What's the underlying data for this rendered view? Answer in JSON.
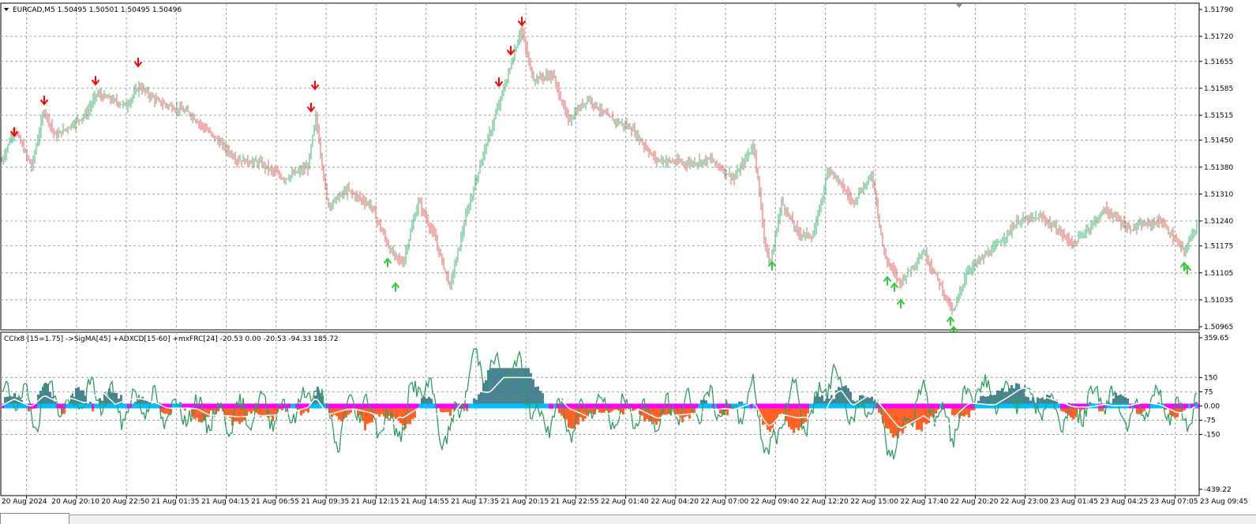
{
  "main": {
    "symbol_line": "EURCAD,M5  1.50495 1.50501 1.50495 1.50496",
    "price_ticks": [
      "1.51790",
      "1.51720",
      "1.51655",
      "1.51585",
      "1.51515",
      "1.51450",
      "1.51380",
      "1.51310",
      "1.51240",
      "1.51175",
      "1.51105",
      "1.51035",
      "1.50965"
    ]
  },
  "indicator": {
    "label": "CCIx8 [15=1.75] ->SigMA[45] +ADXCD[15-60] +mxFRC[24] -20.53 0.00 -20.53 -94.33 185.72",
    "ticks": [
      "359.65",
      "150",
      "75",
      "0.00",
      "-75",
      "-150",
      "-439.22"
    ]
  },
  "time_axis": [
    "20 Aug 2024",
    "20 Aug 20:10",
    "20 Aug 22:50",
    "21 Aug 01:35",
    "21 Aug 04:15",
    "21 Aug 06:55",
    "21 Aug 09:35",
    "21 Aug 12:15",
    "21 Aug 14:55",
    "21 Aug 17:35",
    "21 Aug 20:15",
    "21 Aug 22:55",
    "22 Aug 01:40",
    "22 Aug 04:20",
    "22 Aug 07:00",
    "22 Aug 09:40",
    "22 Aug 12:20",
    "22 Aug 15:00",
    "22 Aug 17:40",
    "22 Aug 20:20",
    "22 Aug 23:00",
    "23 Aug 01:45",
    "23 Aug 04:25",
    "23 Aug 07:05",
    "23 Aug 09:45"
  ],
  "colors": {
    "grid": "#a0a0a0",
    "bull_candle": "#3cb371",
    "bear_candle": "#e06060",
    "arrow_down": "#ff0000",
    "arrow_up": "#32cd32",
    "cci_line": "#2e9e60",
    "positive_fill": "#2a6f7f",
    "negative_fill": "#ff4500",
    "zero_band_pos": "#00bfff",
    "zero_band_neg": "#ff00ff"
  }
}
